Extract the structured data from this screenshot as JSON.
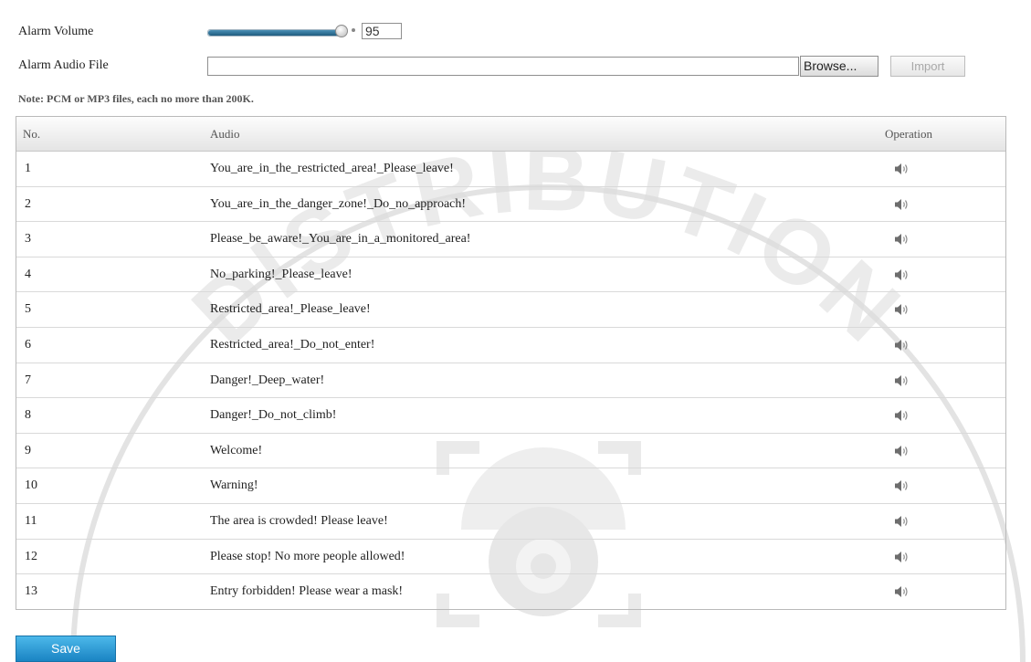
{
  "settings": {
    "volume_label": "Alarm Volume",
    "volume_value": "95",
    "volume_level": 0.95,
    "audio_file_label": "Alarm Audio File",
    "audio_file_value": "",
    "browse_label": "Browse...",
    "import_label": "Import",
    "note": "Note: PCM or MP3 files, each no more than 200K."
  },
  "table": {
    "headers": {
      "no": "No.",
      "audio": "Audio",
      "operation": "Operation"
    },
    "rows": [
      {
        "no": "1",
        "audio": "You_are_in_the_restricted_area!_Please_leave!"
      },
      {
        "no": "2",
        "audio": "You_are_in_the_danger_zone!_Do_no_approach!"
      },
      {
        "no": "3",
        "audio": "Please_be_aware!_You_are_in_a_monitored_area!"
      },
      {
        "no": "4",
        "audio": "No_parking!_Please_leave!"
      },
      {
        "no": "5",
        "audio": "Restricted_area!_Please_leave!"
      },
      {
        "no": "6",
        "audio": "Restricted_area!_Do_not_enter!"
      },
      {
        "no": "7",
        "audio": "Danger!_Deep_water!"
      },
      {
        "no": "8",
        "audio": "Danger!_Do_not_climb!"
      },
      {
        "no": "9",
        "audio": "Welcome!"
      },
      {
        "no": "10",
        "audio": "Warning!"
      },
      {
        "no": "11",
        "audio": "The area is crowded! Please leave!"
      },
      {
        "no": "12",
        "audio": "Please stop! No more people allowed!"
      },
      {
        "no": "13",
        "audio": "Entry forbidden! Please wear a mask!"
      }
    ],
    "operation_icon": "speaker-play-icon"
  },
  "footer": {
    "save_label": "Save"
  },
  "watermark": {
    "text": "DISTRIBUTION",
    "icon": "dome-camera-icon"
  },
  "colors": {
    "save_button": "#1a84c3",
    "slider_fill": "#1f5d80"
  }
}
